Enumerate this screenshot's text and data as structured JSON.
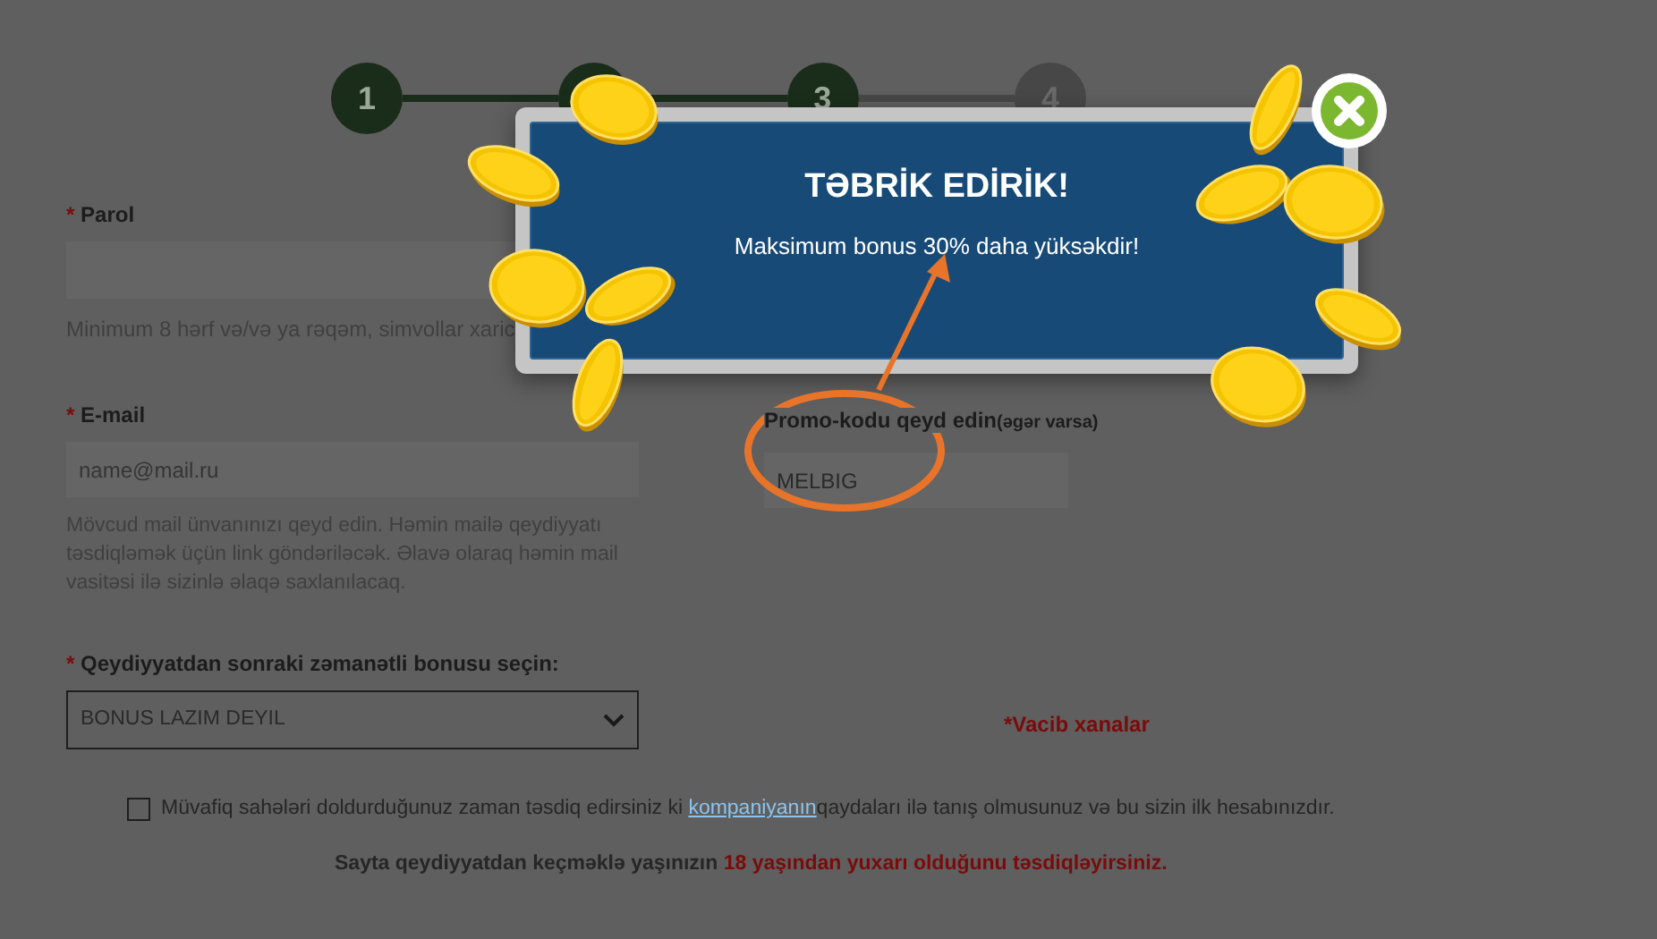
{
  "steps": [
    {
      "label": "1",
      "active": true
    },
    {
      "active": true
    },
    {
      "label": "3",
      "active": true
    },
    {
      "label": "4",
      "active": false
    }
  ],
  "password": {
    "label": "Parol",
    "required": "*",
    "hint": "Minimum 8 hərf və/və ya rəqəm, simvollar xaric"
  },
  "email": {
    "label": "E-mail",
    "required": "*",
    "placeholder": "name@mail.ru",
    "hint": "Mövcud mail ünvanınızı qeyd edin. Həmin mailə qeydiyyatı təsdiqləmək üçün link göndəriləcək. Əlavə olaraq həmin mail vasitəsi ilə sizinlə əlaqə saxlanılacaq."
  },
  "promo": {
    "label": "Promo-kodu qeyd edin",
    "note": "(əgər varsa)",
    "value": "MELBIG"
  },
  "bonus": {
    "label": "Qeydiyyatdan sonraki zəmanətli bonusu seçin:",
    "required": "*",
    "value": "BONUS LAZIM DEYIL"
  },
  "required_note": "*Vacib xanalar",
  "agreement": {
    "checked": false,
    "before": "Müvafiq sahələri doldurduğunuz zaman təsdiq edirsiniz ki ",
    "link": "kompaniyanın",
    "after": "qaydaları ilə tanış olmusunuz və bu sizin ilk hesabınızdır."
  },
  "age_notice": {
    "text": "Sayta qeydiyyatdan keçməklə yaşınızın ",
    "highlight": "18 yaşından yuxarı olduğunu təsdiqləyirsiniz."
  },
  "modal": {
    "title": "TƏBRİK EDİRİK!",
    "message": "Maksimum bonus 30% daha yüksəkdir!"
  }
}
